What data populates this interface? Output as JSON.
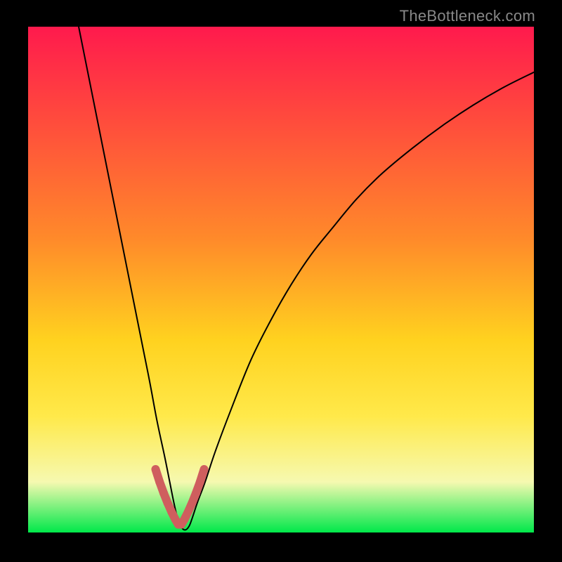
{
  "attribution": "TheBottleneck.com",
  "chart_data": {
    "type": "line",
    "title": "",
    "xlabel": "",
    "ylabel": "",
    "xlim": [
      0,
      100
    ],
    "ylim": [
      0,
      100
    ],
    "series": [
      {
        "name": "main-curve",
        "stroke": "#000000",
        "stroke_width": 2,
        "x": [
          10,
          12,
          14,
          16,
          18,
          20,
          22,
          24,
          25.5,
          27,
          28,
          28.8,
          29.5,
          30.2,
          31,
          31.8,
          32.5,
          33.5,
          35,
          37,
          40,
          44,
          48,
          52,
          56,
          60,
          65,
          70,
          76,
          82,
          88,
          94,
          100
        ],
        "y": [
          100,
          90,
          80,
          70,
          60,
          50,
          40,
          30,
          22,
          15,
          10,
          6,
          3,
          1.2,
          0.5,
          1.2,
          3,
          6,
          10,
          16,
          24,
          34,
          42,
          49,
          55,
          60,
          66,
          71,
          76,
          80.5,
          84.5,
          88,
          91
        ]
      },
      {
        "name": "highlight-segments",
        "stroke": "#cf5e5e",
        "stroke_width": 12,
        "x": [
          25.2,
          26.0,
          26.8,
          27.6,
          28.4,
          29.1,
          29.7,
          30.3,
          30.9,
          31.6,
          32.4,
          33.2,
          34.0,
          34.8
        ],
        "y": [
          12.5,
          10.0,
          7.8,
          5.8,
          4.0,
          2.6,
          1.6,
          1.6,
          2.6,
          4.0,
          5.8,
          7.8,
          10.0,
          12.5
        ]
      }
    ]
  }
}
